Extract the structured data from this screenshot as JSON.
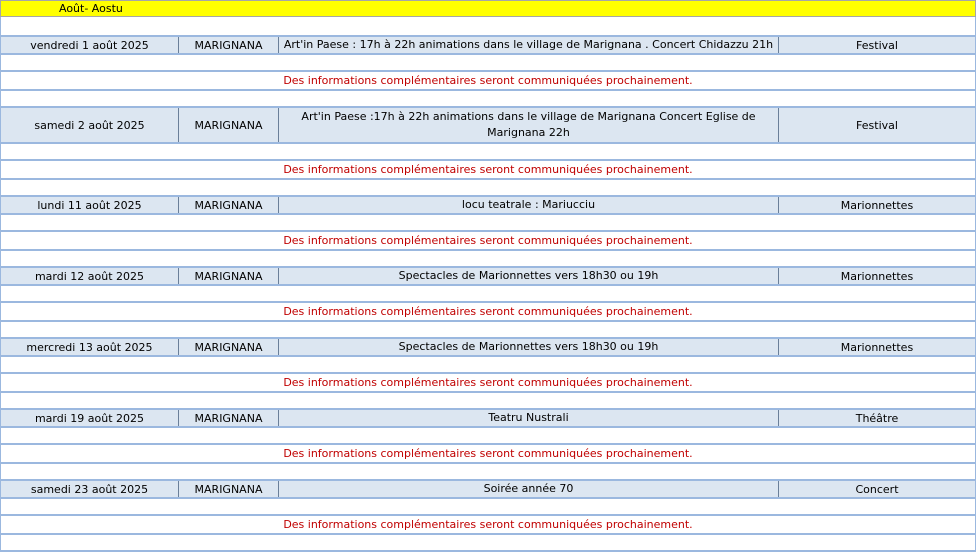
{
  "sheet": {
    "month_title": "Août- Aostu",
    "info_text": "Des informations complémentaires seront communiquées prochainement.",
    "events": [
      {
        "date": "vendredi 1 août 2025",
        "place": "MARIGNANA",
        "description": "Art'in Paese  : 17h à 22h animations dans le village de Marignana . Concert Chidazzu 21h",
        "category": "Festival"
      },
      {
        "date": "samedi 2 août 2025",
        "place": "MARIGNANA",
        "description": "Art'in Paese  :17h à 22h animations dans le village de Marignana   Concert Eglise de Marignana 22h",
        "category": "Festival"
      },
      {
        "date": "lundi 11 août 2025",
        "place": "MARIGNANA",
        "description": "locu teatrale : Mariucciu",
        "category": "Marionnettes"
      },
      {
        "date": "mardi 12 août 2025",
        "place": "MARIGNANA",
        "description": "Spectacles de Marionnettes vers 18h30 ou 19h",
        "category": "Marionnettes"
      },
      {
        "date": "mercredi 13 août 2025",
        "place": "MARIGNANA",
        "description": "Spectacles de Marionnettes vers 18h30 ou 19h",
        "category": "Marionnettes"
      },
      {
        "date": "mardi 19 août 2025",
        "place": "MARIGNANA",
        "description": "Teatru Nustrali",
        "category": "Théâtre"
      },
      {
        "date": "samedi 23 août 2025",
        "place": "MARIGNANA",
        "description": "Soirée année 70",
        "category": "Concert"
      }
    ]
  }
}
